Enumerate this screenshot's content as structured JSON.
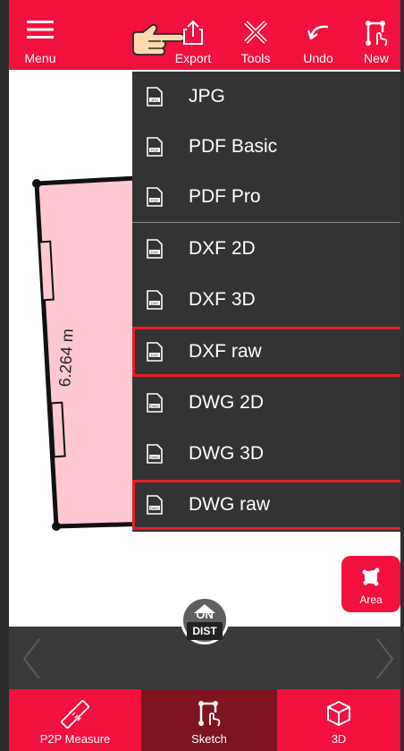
{
  "toolbar": {
    "menu_label": "Menu",
    "export_label": "Export",
    "tools_label": "Tools",
    "undo_label": "Undo",
    "new_label": "New"
  },
  "export_menu": {
    "items": [
      {
        "label": "JPG",
        "badge": "JPG"
      },
      {
        "label": "PDF Basic",
        "badge": "PDF"
      },
      {
        "label": "PDF Pro",
        "badge": "PDF"
      },
      {
        "label": "DXF 2D",
        "badge": "DXF"
      },
      {
        "label": "DXF 3D",
        "badge": "DXF"
      },
      {
        "label": "DXF raw",
        "badge": "DXF"
      },
      {
        "label": "DWG 2D",
        "badge": "DWG"
      },
      {
        "label": "DWG 3D",
        "badge": "DWG"
      },
      {
        "label": "DWG raw",
        "badge": "DWG"
      }
    ],
    "highlighted": [
      "DXF raw",
      "DWG raw"
    ]
  },
  "sketch": {
    "measurement": "6.264 m",
    "fill_color": "#ffc8d2"
  },
  "area_button": {
    "label": "Area"
  },
  "ondist": {
    "on": "ON",
    "dist": "DIST"
  },
  "bottom_tabs": [
    {
      "label": "P2P Measure",
      "icon": "ruler-icon"
    },
    {
      "label": "Sketch",
      "icon": "sketch-icon",
      "active": true
    },
    {
      "label": "3D",
      "icon": "cube-icon"
    }
  ],
  "colors": {
    "accent": "#f2103e",
    "menu_bg": "#333333",
    "highlight": "#e51d2a",
    "active_tab": "#7d1521"
  }
}
